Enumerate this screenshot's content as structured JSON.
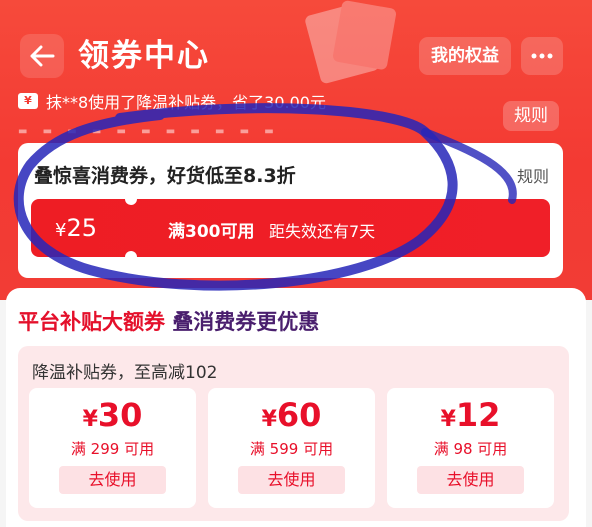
{
  "header": {
    "title": "领券中心",
    "rights_label": "我的权益",
    "notice": "抹**8使用了降温补贴券，省了30.00元",
    "rules_label": "规则",
    "accent": "#f33a33"
  },
  "stack_card": {
    "title": "叠惊喜消费券，好货低至8.3折",
    "rules_label": "规则",
    "coupon": {
      "currency": "¥",
      "amount": "25",
      "condition": "满300可用",
      "expiry": "距失效还有7天"
    },
    "accent": "#ee1d24"
  },
  "platform": {
    "title_part1": "平台补贴大额券",
    "title_part2": "叠消费券更优惠",
    "subsidy": {
      "title": "降温补贴券，至高减102",
      "coupons": [
        {
          "currency": "¥",
          "amount": "30",
          "condition": "满 299 可用",
          "button": "去使用"
        },
        {
          "currency": "¥",
          "amount": "60",
          "condition": "满 599 可用",
          "button": "去使用"
        },
        {
          "currency": "¥",
          "amount": "12",
          "condition": "满 98 可用",
          "button": "去使用"
        }
      ]
    }
  },
  "icons": [
    "back-arrow-icon",
    "more-dots-icon",
    "notice-badge-icon"
  ]
}
